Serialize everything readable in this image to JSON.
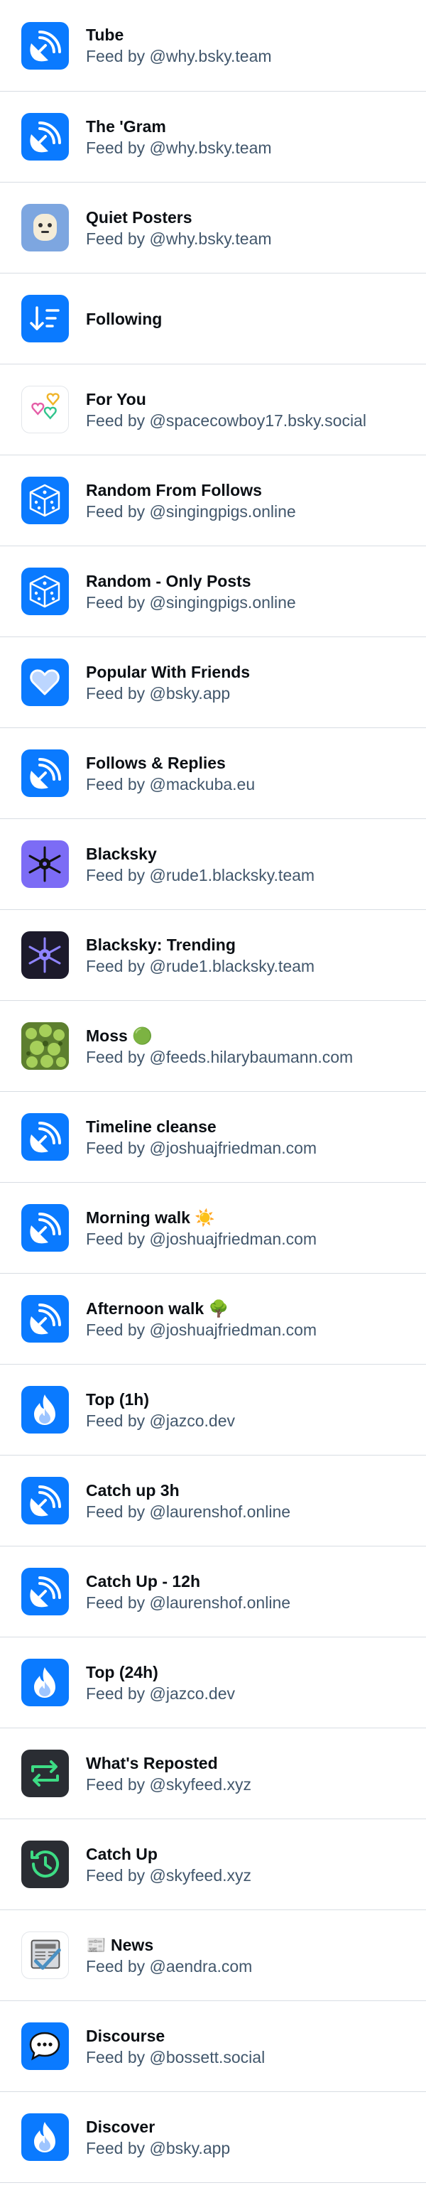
{
  "colors": {
    "accent": "#0a7aff",
    "divider": "#d8dde3",
    "title_text": "#0b0f14",
    "subtitle_text": "#42576c"
  },
  "feeds": [
    {
      "title": "Tube",
      "subtitle": "Feed by @why.bsky.team",
      "icon": "satellite-dish-icon"
    },
    {
      "title": "The 'Gram",
      "subtitle": "Feed by @why.bsky.team",
      "icon": "satellite-dish-icon"
    },
    {
      "title": "Quiet Posters",
      "subtitle": "Feed by @why.bsky.team",
      "icon": "quiet-ghost-icon"
    },
    {
      "title": "Following",
      "subtitle": "",
      "icon": "sort-arrows-icon"
    },
    {
      "title": "For You",
      "subtitle": "Feed by @spacecowboy17.bsky.social",
      "icon": "hearts-icon"
    },
    {
      "title": "Random From Follows",
      "subtitle": "Feed by @singingpigs.online",
      "icon": "dice-icon"
    },
    {
      "title": "Random - Only Posts",
      "subtitle": "Feed by @singingpigs.online",
      "icon": "dice-icon"
    },
    {
      "title": "Popular With Friends",
      "subtitle": "Feed by @bsky.app",
      "icon": "heart-icon"
    },
    {
      "title": "Follows & Replies",
      "subtitle": "Feed by @mackuba.eu",
      "icon": "satellite-dish-icon"
    },
    {
      "title": "Blacksky",
      "subtitle": "Feed by @rude1.blacksky.team",
      "icon": "blacksky-star-icon"
    },
    {
      "title": "Blacksky: Trending",
      "subtitle": "Feed by @rude1.blacksky.team",
      "icon": "blacksky-star-icon"
    },
    {
      "title": "Moss 🟢",
      "subtitle": "Feed by @feeds.hilarybaumann.com",
      "icon": "moss-icon"
    },
    {
      "title": "Timeline cleanse",
      "subtitle": "Feed by @joshuajfriedman.com",
      "icon": "satellite-dish-icon"
    },
    {
      "title": "Morning walk ☀️",
      "subtitle": "Feed by @joshuajfriedman.com",
      "icon": "satellite-dish-icon"
    },
    {
      "title": "Afternoon walk 🌳",
      "subtitle": "Feed by @joshuajfriedman.com",
      "icon": "satellite-dish-icon"
    },
    {
      "title": "Top (1h)",
      "subtitle": "Feed by @jazco.dev",
      "icon": "flame-icon"
    },
    {
      "title": "Catch up 3h",
      "subtitle": "Feed by @laurenshof.online",
      "icon": "satellite-dish-icon"
    },
    {
      "title": "Catch Up - 12h",
      "subtitle": "Feed by @laurenshof.online",
      "icon": "satellite-dish-icon"
    },
    {
      "title": "Top (24h)",
      "subtitle": "Feed by @jazco.dev",
      "icon": "flame-icon"
    },
    {
      "title": "What's Reposted",
      "subtitle": "Feed by @skyfeed.xyz",
      "icon": "repost-icon"
    },
    {
      "title": "Catch Up",
      "subtitle": "Feed by @skyfeed.xyz",
      "icon": "history-clock-icon"
    },
    {
      "title": "📰 News",
      "subtitle": "Feed by @aendra.com",
      "icon": "newspaper-check-icon"
    },
    {
      "title": "Discourse",
      "subtitle": "Feed by @bossett.social",
      "icon": "speech-bubble-icon"
    },
    {
      "title": "Discover",
      "subtitle": "Feed by @bsky.app",
      "icon": "flame-icon"
    }
  ]
}
